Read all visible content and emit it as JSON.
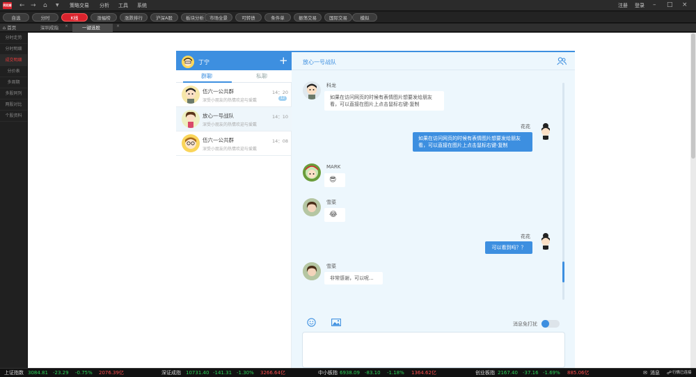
{
  "app": {
    "logo": "同花顺"
  },
  "menu": [
    "策略交易",
    "分析",
    "工具",
    "系统"
  ],
  "window": {
    "register": "注册",
    "login": "登录"
  },
  "toolbar": [
    "自选",
    "分时",
    "K线",
    "涨幅榜",
    "涨跌排行",
    "沪深A股",
    "板块分析",
    "市场全景",
    "可转债",
    "条件单",
    "振荡交易",
    "国际交易",
    "模拟"
  ],
  "toolbar_active": 2,
  "tabs": [
    {
      "label": "首页",
      "icon": "home-icon"
    },
    {
      "label": "深圳成指"
    },
    {
      "label": "一键选股"
    }
  ],
  "sidebar": [
    "分时走势",
    "分时明细",
    "成交明细",
    "分价表",
    "多周期",
    "多股同列",
    "两股对比",
    "个股资料"
  ],
  "sidebar_active": 2,
  "chat": {
    "me": {
      "name": "丁宁"
    },
    "tabs": {
      "group": "群聊",
      "private": "私聊"
    },
    "conversations": [
      {
        "name": "伍六一公共群",
        "sub": "深受小朋友的热情欢迎与爱戴",
        "time": "14：20",
        "badge": "12"
      },
      {
        "name": "放心一号战队",
        "sub": "深受小朋友的热情欢迎与爱戴",
        "time": "14：10"
      },
      {
        "name": "伍六一公共群",
        "sub": "深受小朋友的热情欢迎与爱戴",
        "time": "14：08"
      }
    ],
    "room_title": "放心一号战队",
    "messages": [
      {
        "sender": "科龙",
        "text1": "如果在访问网页的时候有表情图片想要发给朋友",
        "text2": "看，可以直接在图片上点击鼠标右键-复制"
      },
      {
        "sender": "花花",
        "text1": "如果在访问网页的时候有表情图片想要发给朋友",
        "text2": "看，可以直接在图片上点击鼠标右键-复制"
      },
      {
        "sender": "MARK",
        "emoji": "😎"
      },
      {
        "sender": "雪菜",
        "emoji": "😂"
      },
      {
        "sender": "花花",
        "text1": "可以看到吗？？"
      },
      {
        "sender": "雪菜",
        "text1": "非常感谢，可以呢..."
      }
    ],
    "dnd_label": "消息免打扰"
  },
  "status": {
    "idx1": {
      "name": "上证指数",
      "value": "3084.81",
      "chg": "-23.29",
      "pct": "-0.75%",
      "amt": "2076.39亿"
    },
    "idx2": {
      "name": "深证成指",
      "value": "10731.40",
      "chg": "-141.31",
      "pct": "-1.30%",
      "amt": "3266.64亿"
    },
    "idx3": {
      "name": "中小板指",
      "value": "6938.09",
      "chg": "-83.10",
      "pct": "-1.18%",
      "amt": "1364.62亿"
    },
    "idx4": {
      "name": "创业板指",
      "value": "2167.40",
      "chg": "-37.16",
      "pct": "-1.69%",
      "amt": "885.06亿"
    },
    "msg": "消息",
    "conn": "行情已连接"
  },
  "colors": {
    "accent": "#3d8fe0",
    "brand_red": "#d9232d",
    "up": "#2fd35a",
    "down": "#ff5050"
  }
}
